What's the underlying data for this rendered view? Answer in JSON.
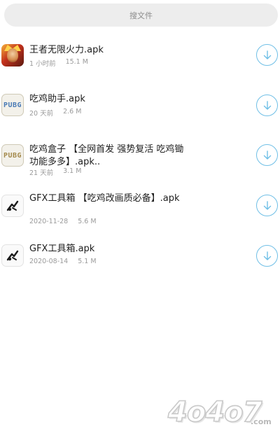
{
  "search": {
    "placeholder": "搜文件"
  },
  "files": [
    {
      "name": "王者无限火力.apk",
      "time": "1 小时前",
      "size": "15.1 M",
      "icon": "game-hero-icon"
    },
    {
      "name": "吃鸡助手.apk",
      "time": "20 天前",
      "size": "2.6 M",
      "icon": "pubg-icon"
    },
    {
      "name": "吃鸡盒子 【全网首发 强势复活 吃鸡锄 功能多多】.apk..",
      "time": "21 天前",
      "size": "3.1 M",
      "icon": "pubg-icon"
    },
    {
      "name": "GFX工具箱 【吃鸡改画质必备】.apk",
      "time": "2020-11-28",
      "size": "5.6 M",
      "icon": "gfx-tool-icon"
    },
    {
      "name": "GFX工具箱.apk",
      "time": "2020-08-14",
      "size": "5.1 M",
      "icon": "gfx-tool-icon"
    }
  ],
  "icons": {
    "pubg_label": "PUBG"
  },
  "watermark": {
    "text": "4o4o7",
    "suffix": ".com"
  },
  "colors": {
    "accent": "#6fbfe6",
    "search_bg": "#ededed",
    "meta_text": "#9a9a9a"
  }
}
